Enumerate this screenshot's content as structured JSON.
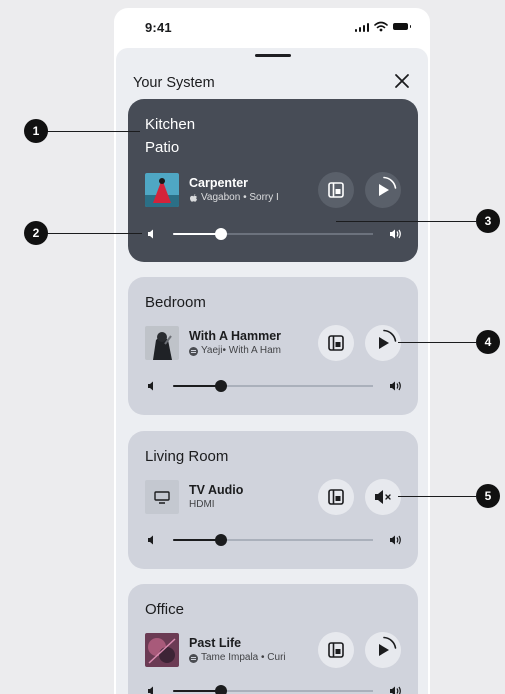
{
  "status_bar": {
    "time": "9:41"
  },
  "sheet": {
    "title": "Your System"
  },
  "rooms": [
    {
      "rooms_label": [
        "Kitchen",
        "Patio"
      ],
      "track": {
        "title": "Carpenter",
        "subtitle": "Vagabon • Sorry I",
        "service_icon": "apple-music-icon"
      },
      "state": "paused",
      "volume": 0.25
    },
    {
      "name": "Bedroom",
      "track": {
        "title": "With A Hammer",
        "subtitle": "Yaeji• With A Ham",
        "service_icon": "sonos-radio-icon"
      },
      "state": "paused",
      "volume": 0.25
    },
    {
      "name": "Living Room",
      "track": {
        "title": "TV Audio",
        "subtitle": "HDMI",
        "service_icon": "tv-icon"
      },
      "state": "muted",
      "volume": 0.25
    },
    {
      "name": "Office",
      "track": {
        "title": "Past Life",
        "subtitle": "Tame Impala • Curi",
        "service_icon": "sonos-radio-icon"
      },
      "state": "paused",
      "volume": 0.25
    }
  ],
  "callouts": [
    "1",
    "2",
    "3",
    "4",
    "5"
  ],
  "colors": {
    "dark_card": "#474c56",
    "light_card": "#d0d3dc",
    "sheet": "#eceef2",
    "badge": "#111111"
  }
}
